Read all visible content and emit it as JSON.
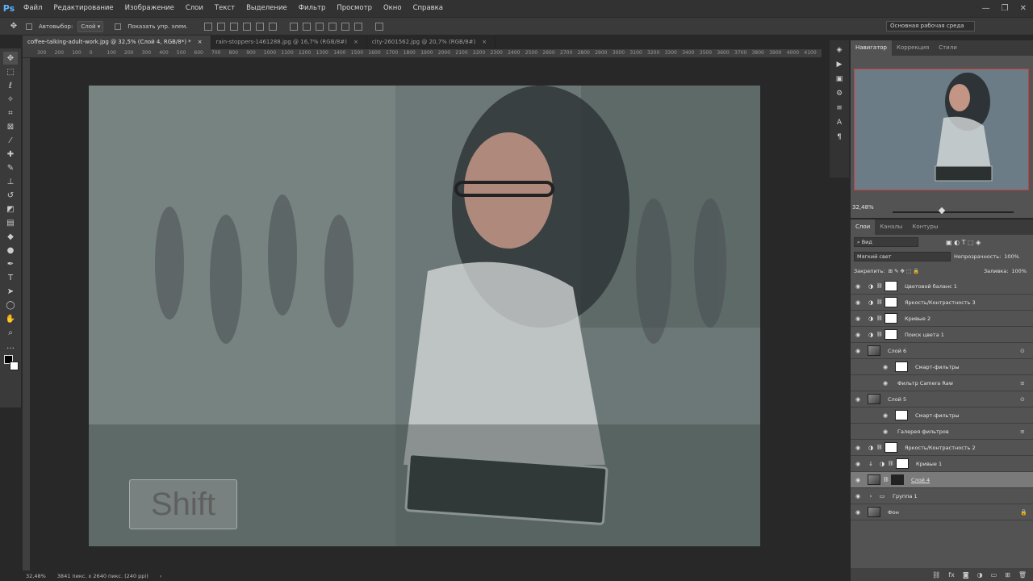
{
  "app": {
    "logo": "Ps"
  },
  "menu": [
    "Файл",
    "Редактирование",
    "Изображение",
    "Слои",
    "Текст",
    "Выделение",
    "Фильтр",
    "Просмотр",
    "Окно",
    "Справка"
  ],
  "window_controls": {
    "minimize": "—",
    "restore": "❐",
    "close": "✕"
  },
  "options": {
    "autoselect_label": "Автовыбор:",
    "autoselect_value": "Слой",
    "show_controls_label": "Показать упр. элем."
  },
  "workspace": "Основная рабочая среда",
  "tabs": [
    {
      "label": "coffee-talking-adult-work.jpg @ 32,5% (Слой 4, RGB/8*) *",
      "close": "×"
    },
    {
      "label": "rain-stoppers-1461288.jpg @ 16,7% (RGB/8#)",
      "close": "×"
    },
    {
      "label": "city-2601562.jpg @ 20,7% (RGB/8#)",
      "close": "×"
    }
  ],
  "ruler_h": [
    "300",
    "200",
    "100",
    "0",
    "100",
    "200",
    "300",
    "400",
    "500",
    "600",
    "700",
    "800",
    "900",
    "1000",
    "1100",
    "1200",
    "1300",
    "1400",
    "1500",
    "1600",
    "1700",
    "1800",
    "1900",
    "2000",
    "2100",
    "2200",
    "2300",
    "2400",
    "2500",
    "2600",
    "2700",
    "2800",
    "2900",
    "3000",
    "3100",
    "3200",
    "3300",
    "3400",
    "3500",
    "3600",
    "3700",
    "3800",
    "3900",
    "4000",
    "4100"
  ],
  "status": {
    "zoom": "32,48%",
    "size": "3841 пикс. x 2640 пикс. (240 ppi)",
    "arrow": "›"
  },
  "overlay_key": "Shift",
  "navigator": {
    "tabs": [
      "Навигатор",
      "Коррекция",
      "Стили"
    ],
    "zoom": "32,48%"
  },
  "layers_panel": {
    "tabs": [
      "Слои",
      "Каналы",
      "Контуры"
    ],
    "filter": "Вид",
    "blend_mode": "Мягкий свет",
    "opacity_label": "Непрозрачность:",
    "opacity": "100%",
    "lock_label": "Закрепить:",
    "fill_label": "Заливка:",
    "fill": "100%",
    "layers": [
      {
        "name": "Цветовой баланс 1"
      },
      {
        "name": "Яркость/Контрастность 3"
      },
      {
        "name": "Кривые 2"
      },
      {
        "name": "Поиск цвета 1"
      },
      {
        "name": "Слой 6"
      },
      {
        "name": "Смарт-фильтры"
      },
      {
        "name": "Фильтр Camera Raw"
      },
      {
        "name": "Слой 5"
      },
      {
        "name": "Смарт-фильтры"
      },
      {
        "name": "Галерея фильтров"
      },
      {
        "name": "Яркость/Контрастность 2"
      },
      {
        "name": "Кривые 1"
      },
      {
        "name": "Слой 4"
      },
      {
        "name": "Группа 1"
      },
      {
        "name": "Фон"
      }
    ]
  },
  "colors": {
    "accent": "#c73e3e",
    "panel": "#535353",
    "selected": "#7a7a7a"
  }
}
